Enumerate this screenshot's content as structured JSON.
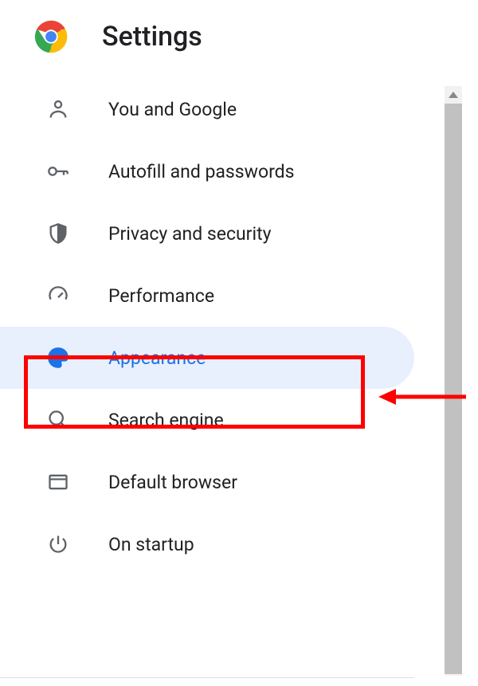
{
  "header": {
    "title": "Settings"
  },
  "menu": {
    "items": [
      {
        "icon": "person-icon",
        "label": "You and Google",
        "selected": false
      },
      {
        "icon": "key-icon",
        "label": "Autofill and passwords",
        "selected": false
      },
      {
        "icon": "shield-icon",
        "label": "Privacy and security",
        "selected": false
      },
      {
        "icon": "speedometer-icon",
        "label": "Performance",
        "selected": false
      },
      {
        "icon": "palette-icon",
        "label": "Appearance",
        "selected": true
      },
      {
        "icon": "search-icon",
        "label": "Search engine",
        "selected": false
      },
      {
        "icon": "browser-icon",
        "label": "Default browser",
        "selected": false
      },
      {
        "icon": "power-icon",
        "label": "On startup",
        "selected": false
      }
    ]
  },
  "annotations": {
    "highlight_color": "#ff0000",
    "arrow_color": "#ff0000"
  }
}
